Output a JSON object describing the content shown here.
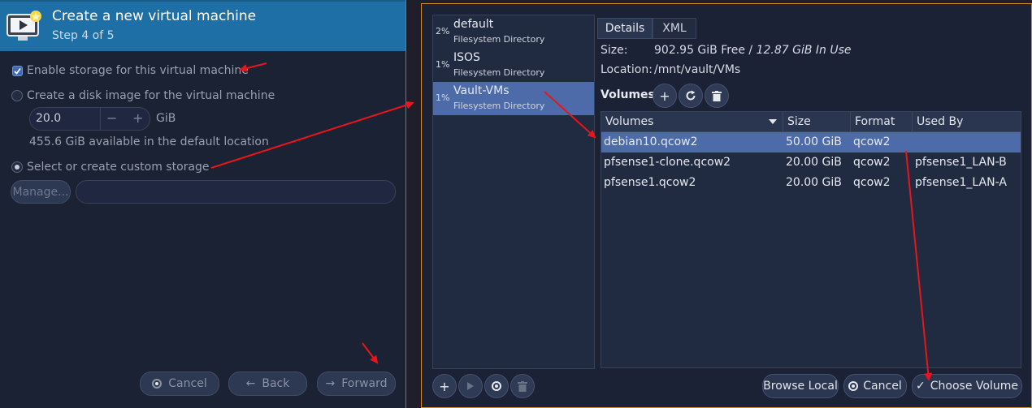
{
  "wizard": {
    "title": "Create a new virtual machine",
    "step": "Step 4 of 5",
    "enable_storage_label": "Enable storage for this virtual machine",
    "create_disk_label": "Create a disk image for the virtual machine",
    "disk_size_value": "20.0",
    "minus_label": "−",
    "plus_label": "+",
    "size_unit": "GiB",
    "available_text": "455.6 GiB available in the default location",
    "custom_storage_label": "Select or create custom storage",
    "manage_label": "Manage...",
    "storage_path_value": "",
    "cancel_label": "Cancel",
    "back_label": "Back",
    "forward_label": "Forward"
  },
  "pools": [
    {
      "pct": "2%",
      "name": "default",
      "type": "Filesystem Directory",
      "selected": false
    },
    {
      "pct": "1%",
      "name": "ISOS",
      "type": "Filesystem Directory",
      "selected": false
    },
    {
      "pct": "1%",
      "name": "Vault-VMs",
      "type": "Filesystem Directory",
      "selected": true
    }
  ],
  "details": {
    "tabs": [
      "Details",
      "XML"
    ],
    "size_label": "Size:",
    "size_free": "902.95 GiB Free / ",
    "size_in_use": "12.87 GiB In Use",
    "location_label": "Location:",
    "location_value": "/mnt/vault/VMs",
    "volumes_label": "Volumes",
    "columns": [
      "Volumes",
      "Size",
      "Format",
      "Used By"
    ],
    "volumes": [
      {
        "name": "debian10.qcow2",
        "size": "50.00 GiB",
        "format": "qcow2",
        "used_by": ""
      },
      {
        "name": "pfsense1-clone.qcow2",
        "size": "20.00 GiB",
        "format": "qcow2",
        "used_by": "pfsense1_LAN-B"
      },
      {
        "name": "pfsense1.qcow2",
        "size": "20.00 GiB",
        "format": "qcow2",
        "used_by": "pfsense1_LAN-A"
      }
    ]
  },
  "dialog_buttons": {
    "browse_local": "Browse Local",
    "cancel": "Cancel",
    "choose_volume": "Choose Volume"
  },
  "icons": {
    "add": "plus-icon",
    "refresh": "refresh-icon",
    "delete": "trash-icon",
    "play": "play-icon",
    "stop": "stop-icon"
  },
  "colors": {
    "header_blue": "#1e6fa6",
    "selection": "#4c6ba8",
    "annotation_red": "#e8151a",
    "right_window_border": "#d68a2a"
  }
}
